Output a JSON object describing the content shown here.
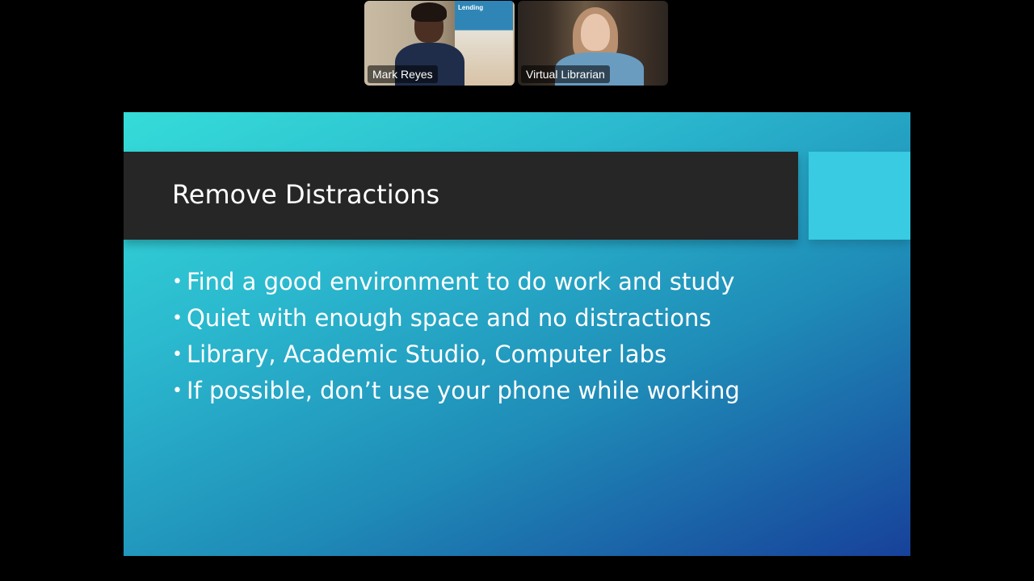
{
  "participants": [
    {
      "name": "Mark Reyes",
      "poster_text": "Lending"
    },
    {
      "name": "Virtual Librarian"
    }
  ],
  "slide": {
    "title": "Remove Distractions",
    "bullet_glyph": "•",
    "bullets": [
      "Find a good environment to do work and study",
      "Quiet with enough space and no distractions",
      "Library, Academic Studio, Computer labs",
      "If possible, don’t use your phone while working"
    ]
  },
  "colors": {
    "background": "#000000",
    "title_bar": "#262626",
    "accent_box": "#38cbe2",
    "slide_gradient_start": "#35dcd8",
    "slide_gradient_end": "#17419a"
  }
}
